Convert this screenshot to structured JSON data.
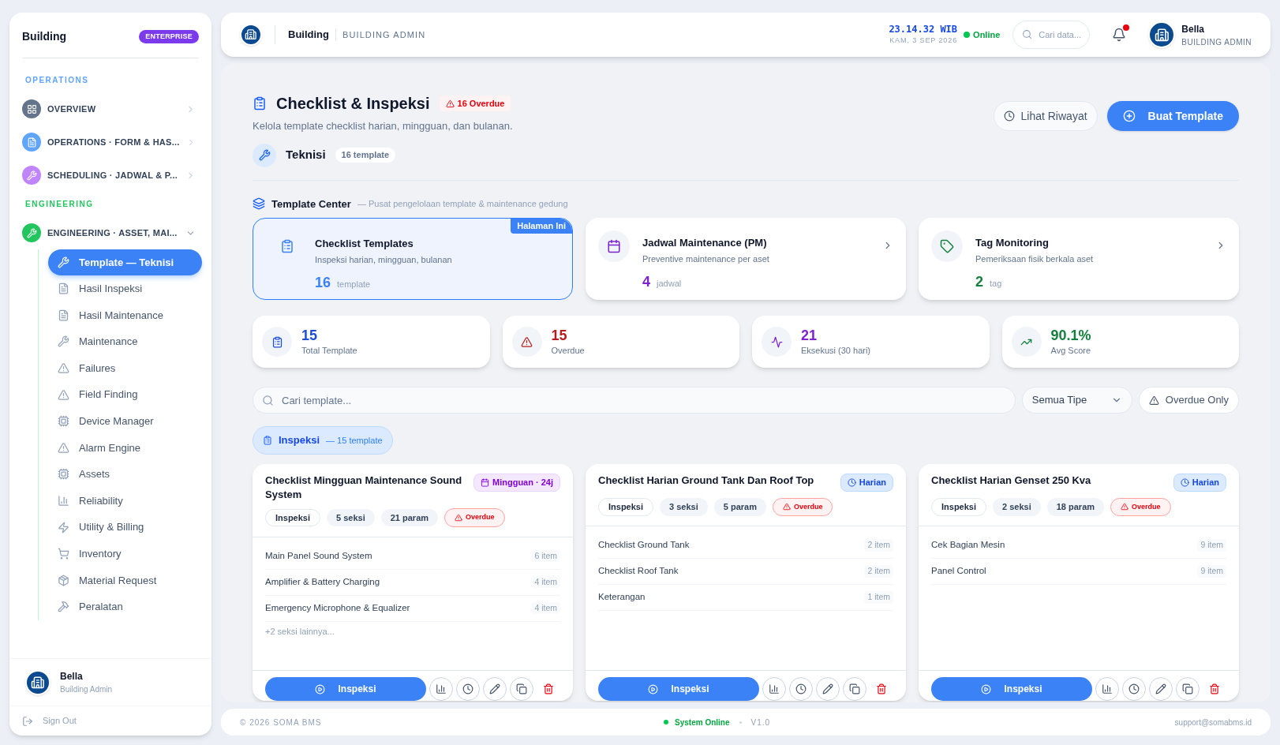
{
  "sidebar": {
    "brand": "Building",
    "plan_badge": "ENTERPRISE",
    "sections": [
      {
        "label": "OPERATIONS",
        "color": "#60a5fa",
        "groups": [
          {
            "label": "OVERVIEW",
            "color": "#64748b",
            "expanded": false
          },
          {
            "label": "OPERATIONS · FORM & HAS...",
            "color": "#60a5fa",
            "expanded": false
          },
          {
            "label": "SCHEDULING · JADWAL & P...",
            "color": "#c084fc",
            "expanded": false
          }
        ]
      },
      {
        "label": "ENGINEERING",
        "color": "#22c55e",
        "groups": [
          {
            "label": "ENGINEERING · ASSET, MAI...",
            "color": "#22c55e",
            "expanded": true,
            "children": [
              {
                "label": "Template — Teknisi",
                "selected": true
              },
              {
                "label": "Hasil Inspeksi",
                "selected": false
              },
              {
                "label": "Hasil Maintenance",
                "selected": false
              },
              {
                "label": "Maintenance",
                "selected": false
              },
              {
                "label": "Failures",
                "selected": false
              },
              {
                "label": "Field Finding",
                "selected": false
              },
              {
                "label": "Device Manager",
                "selected": false
              },
              {
                "label": "Alarm Engine",
                "selected": false
              },
              {
                "label": "Assets",
                "selected": false
              },
              {
                "label": "Reliability",
                "selected": false
              },
              {
                "label": "Utility & Billing",
                "selected": false
              },
              {
                "label": "Inventory",
                "selected": false
              },
              {
                "label": "Material Request",
                "selected": false
              },
              {
                "label": "Peralatan",
                "selected": false
              }
            ]
          }
        ]
      }
    ],
    "user": {
      "name": "Bella",
      "role": "Building Admin"
    },
    "sign_out": "Sign Out"
  },
  "topbar": {
    "app": "Building",
    "role": "BUILDING ADMIN",
    "time": "23.14.32 WIB",
    "date": "KAM, 3 SEP 2026",
    "status": "Online",
    "search_placeholder": "Cari data...",
    "notifications": true,
    "user": {
      "name": "Bella",
      "role": "BUILDING ADMIN"
    }
  },
  "page": {
    "title": "Checklist & Inspeksi",
    "overdue_badge": "16 Overdue",
    "subtitle": "Kelola template checklist harian, mingguan, dan bulanan.",
    "buttons": [
      {
        "label": "Lihat Riwayat",
        "kind": "secondary"
      },
      {
        "label": "Buat Template",
        "kind": "primary"
      }
    ],
    "role": {
      "label": "Teknisi",
      "count": "16 template"
    },
    "center": {
      "title": "Template Center",
      "subtitle": "— Pusat pengelolaan template & maintenance gedung",
      "cards": [
        {
          "title": "Checklist Templates",
          "desc": "Inspeksi harian, mingguan, bulanan",
          "value": "16",
          "unit": "template",
          "color": "#3b82f6",
          "selected": true,
          "current_badge": "Halaman Ini"
        },
        {
          "title": "Jadwal Maintenance (PM)",
          "desc": "Preventive maintenance per aset",
          "value": "4",
          "unit": "jadwal",
          "color": "#7e22ce",
          "selected": false
        },
        {
          "title": "Tag Monitoring",
          "desc": "Pemeriksaan fisik berkala aset",
          "value": "2",
          "unit": "tag",
          "color": "#15803d",
          "selected": false
        }
      ]
    },
    "stats": [
      {
        "value": "15",
        "label": "Total Template",
        "color": "#1d4ed8"
      },
      {
        "value": "15",
        "label": "Overdue",
        "color": "#b91c1c"
      },
      {
        "value": "21",
        "label": "Eksekusi (30 hari)",
        "color": "#7e22ce"
      },
      {
        "value": "90.1%",
        "label": "Avg Score",
        "color": "#15803d"
      }
    ],
    "filters": {
      "search_placeholder": "Cari template...",
      "type_select": "Semua Tipe",
      "overdue_toggle": {
        "label": "Overdue Only",
        "on": false
      }
    },
    "group": {
      "label": "Inspeksi",
      "count": "— 15 template"
    },
    "templates": [
      {
        "title": "Checklist Mingguan Maintenance Sound System",
        "frequency": {
          "label": "Mingguan · 24j",
          "kind": "weekly"
        },
        "tags": [
          {
            "label": "Inspeksi",
            "kind": "type"
          },
          {
            "label": "5 seksi",
            "kind": "count"
          },
          {
            "label": "21 param",
            "kind": "count"
          },
          {
            "label": "Overdue",
            "kind": "overdue"
          }
        ],
        "sections": [
          {
            "name": "Main Panel Sound System",
            "count": "6 item"
          },
          {
            "name": "Amplifier & Battery Charging",
            "count": "4 item"
          },
          {
            "name": "Emergency Microphone & Equalizer",
            "count": "4 item"
          }
        ],
        "more": "+2 seksi lainnya...",
        "action": "Inspeksi"
      },
      {
        "title": "Checklist Harian Ground Tank Dan Roof Top",
        "frequency": {
          "label": "Harian",
          "kind": "daily"
        },
        "tags": [
          {
            "label": "Inspeksi",
            "kind": "type"
          },
          {
            "label": "3 seksi",
            "kind": "count"
          },
          {
            "label": "5 param",
            "kind": "count"
          },
          {
            "label": "Overdue",
            "kind": "overdue"
          }
        ],
        "sections": [
          {
            "name": "Checklist Ground Tank",
            "count": "2 item"
          },
          {
            "name": "Checklist Roof Tank",
            "count": "2 item"
          },
          {
            "name": "Keterangan",
            "count": "1 item"
          }
        ],
        "action": "Inspeksi"
      },
      {
        "title": "Checklist Harian Genset 250 Kva",
        "frequency": {
          "label": "Harian",
          "kind": "daily"
        },
        "tags": [
          {
            "label": "Inspeksi",
            "kind": "type"
          },
          {
            "label": "2 seksi",
            "kind": "count"
          },
          {
            "label": "18 param",
            "kind": "count"
          },
          {
            "label": "Overdue",
            "kind": "overdue"
          }
        ],
        "sections": [
          {
            "name": "Cek Bagian Mesin",
            "count": "9 item"
          },
          {
            "name": "Panel Control",
            "count": "9 item"
          }
        ],
        "action": "Inspeksi"
      }
    ]
  },
  "footer": {
    "copyright": "© 2026 SOMA BMS",
    "status": "System Online",
    "version": "V1.0",
    "email": "support@somabms.id"
  }
}
